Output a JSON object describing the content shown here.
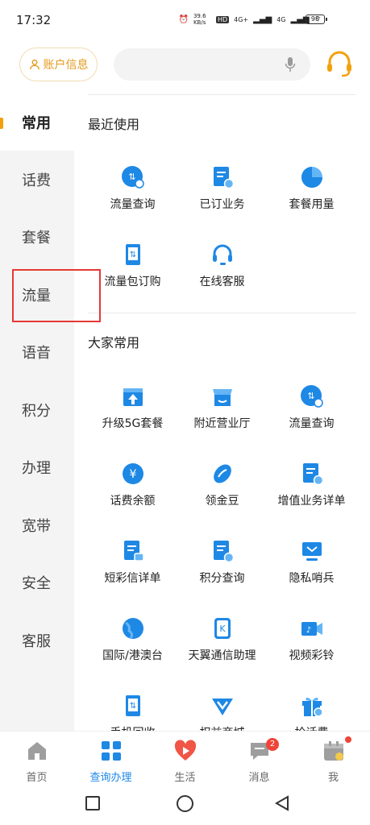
{
  "status": {
    "time": "17:32",
    "net_speed": "39.6 KB/s",
    "hd": "HD",
    "sig1": "4G+",
    "sig2": "4G",
    "battery": "98"
  },
  "header": {
    "account_label": "账户信息"
  },
  "sidebar": {
    "items": [
      {
        "label": "常用",
        "active": true
      },
      {
        "label": "话费"
      },
      {
        "label": "套餐"
      },
      {
        "label": "流量"
      },
      {
        "label": "语音"
      },
      {
        "label": "积分"
      },
      {
        "label": "办理"
      },
      {
        "label": "宽带"
      },
      {
        "label": "安全"
      },
      {
        "label": "客服"
      }
    ]
  },
  "recent": {
    "title": "最近使用",
    "items": [
      {
        "label": "流量查询",
        "icon": "data-query-icon"
      },
      {
        "label": "已订业务",
        "icon": "subscribed-services-icon"
      },
      {
        "label": "套餐用量",
        "icon": "plan-usage-icon"
      },
      {
        "label": "流量包订购",
        "icon": "data-package-icon"
      },
      {
        "label": "在线客服",
        "icon": "online-service-icon"
      }
    ]
  },
  "popular": {
    "title": "大家常用",
    "items": [
      {
        "label": "升级5G套餐",
        "icon": "upgrade-5g-icon"
      },
      {
        "label": "附近营业厅",
        "icon": "nearby-store-icon"
      },
      {
        "label": "流量查询",
        "icon": "data-query-icon"
      },
      {
        "label": "话费余额",
        "icon": "balance-icon"
      },
      {
        "label": "领金豆",
        "icon": "gold-bean-icon"
      },
      {
        "label": "增值业务详单",
        "icon": "value-added-details-icon"
      },
      {
        "label": "短彩信详单",
        "icon": "sms-details-icon"
      },
      {
        "label": "积分查询",
        "icon": "points-query-icon"
      },
      {
        "label": "隐私哨兵",
        "icon": "privacy-sentinel-icon"
      },
      {
        "label": "国际/港澳台",
        "icon": "international-icon"
      },
      {
        "label": "天翼通信助理",
        "icon": "assistant-icon"
      },
      {
        "label": "视频彩铃",
        "icon": "video-ringtone-icon"
      },
      {
        "label": "手机回收",
        "icon": "phone-recycle-icon"
      },
      {
        "label": "权益商城",
        "icon": "benefits-mall-icon"
      },
      {
        "label": "抢话费",
        "icon": "grab-credit-icon"
      }
    ]
  },
  "bottom_nav": {
    "items": [
      {
        "label": "首页"
      },
      {
        "label": "查询办理",
        "active": true
      },
      {
        "label": "生活"
      },
      {
        "label": "消息",
        "badge": "2"
      },
      {
        "label": "我"
      }
    ]
  },
  "colors": {
    "accent": "#1e88e5",
    "orange": "#f2a10d",
    "highlight": "#e53935"
  }
}
